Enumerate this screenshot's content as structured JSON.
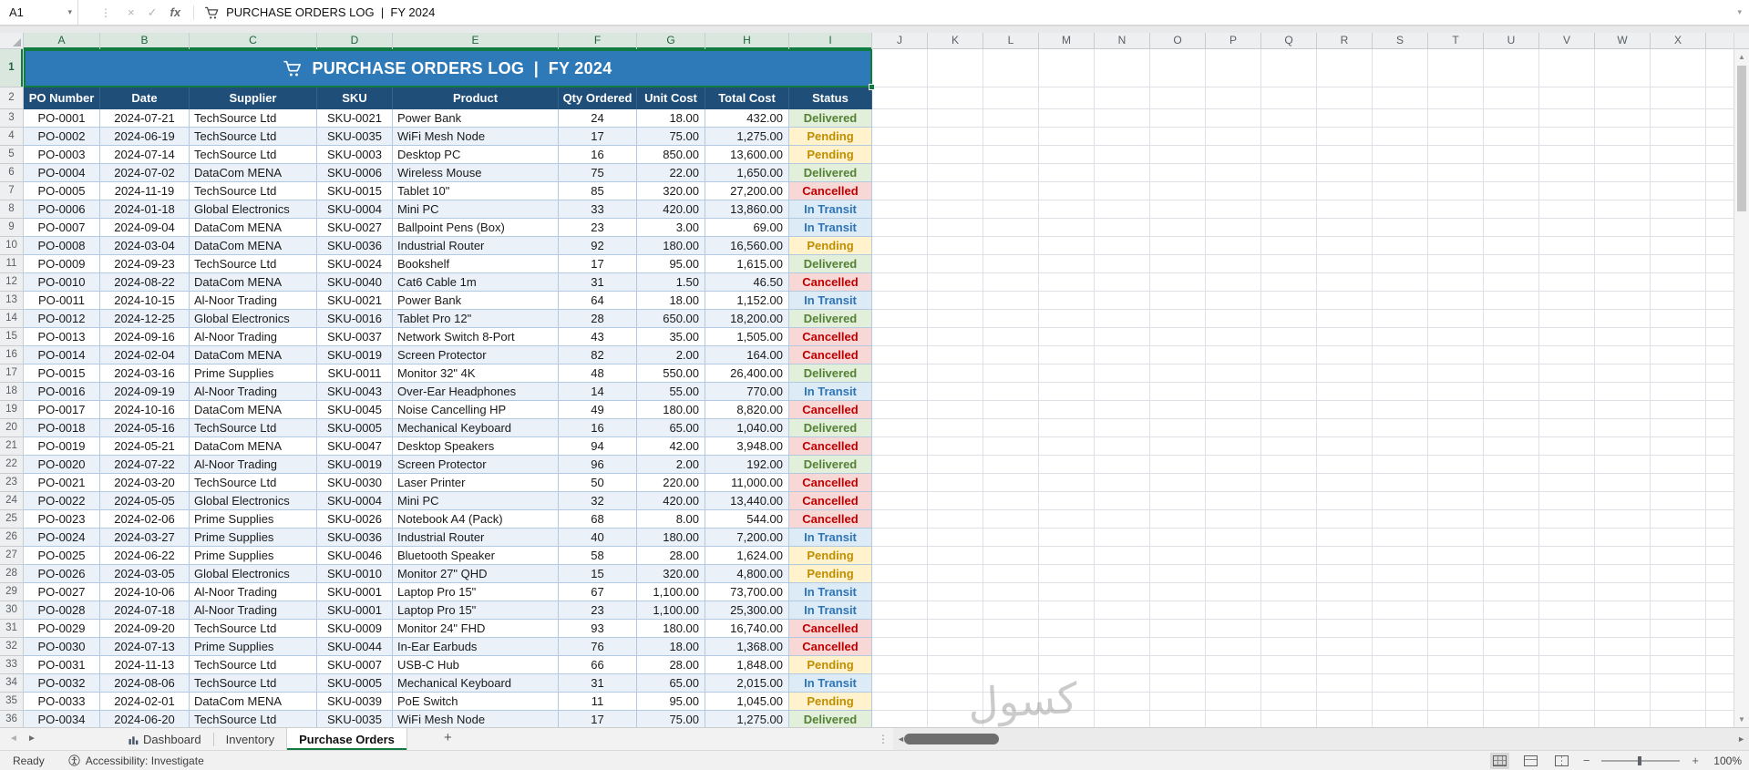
{
  "formula_bar": {
    "name_box": "A1",
    "fx_label": "fx",
    "formula_text": "PURCHASE ORDERS LOG  |  FY 2024"
  },
  "icons": {
    "dropdown": "▾",
    "cancel": "×",
    "confirm": "✓",
    "dots": "⋮",
    "tab_prev": "◄",
    "tab_next": "►",
    "scroll_left": "◄",
    "scroll_right": "►",
    "scroll_up": "▲",
    "scroll_down": "▼",
    "add_sheet": "+",
    "zoom_out": "−",
    "zoom_in": "+"
  },
  "grid": {
    "column_letters": [
      "A",
      "B",
      "C",
      "D",
      "E",
      "F",
      "G",
      "H",
      "I",
      "J",
      "K",
      "L",
      "M",
      "N",
      "O",
      "P",
      "Q",
      "R",
      "S",
      "T",
      "U",
      "V",
      "W",
      "X"
    ],
    "row_count": 36,
    "title": "PURCHASE ORDERS LOG  |  FY 2024",
    "columns": [
      "PO Number",
      "Date",
      "Supplier",
      "SKU",
      "Product",
      "Qty Ordered",
      "Unit Cost",
      "Total Cost",
      "Status"
    ],
    "rows": [
      [
        "PO-0001",
        "2024-07-21",
        "TechSource Ltd",
        "SKU-0021",
        "Power Bank",
        "24",
        "18.00",
        "432.00",
        "Delivered"
      ],
      [
        "PO-0002",
        "2024-06-19",
        "TechSource Ltd",
        "SKU-0035",
        "WiFi Mesh Node",
        "17",
        "75.00",
        "1,275.00",
        "Pending"
      ],
      [
        "PO-0003",
        "2024-07-14",
        "TechSource Ltd",
        "SKU-0003",
        "Desktop PC",
        "16",
        "850.00",
        "13,600.00",
        "Pending"
      ],
      [
        "PO-0004",
        "2024-07-02",
        "DataCom MENA",
        "SKU-0006",
        "Wireless Mouse",
        "75",
        "22.00",
        "1,650.00",
        "Delivered"
      ],
      [
        "PO-0005",
        "2024-11-19",
        "TechSource Ltd",
        "SKU-0015",
        "Tablet 10\"",
        "85",
        "320.00",
        "27,200.00",
        "Cancelled"
      ],
      [
        "PO-0006",
        "2024-01-18",
        "Global Electronics",
        "SKU-0004",
        "Mini PC",
        "33",
        "420.00",
        "13,860.00",
        "In Transit"
      ],
      [
        "PO-0007",
        "2024-09-04",
        "DataCom MENA",
        "SKU-0027",
        "Ballpoint Pens (Box)",
        "23",
        "3.00",
        "69.00",
        "In Transit"
      ],
      [
        "PO-0008",
        "2024-03-04",
        "DataCom MENA",
        "SKU-0036",
        "Industrial Router",
        "92",
        "180.00",
        "16,560.00",
        "Pending"
      ],
      [
        "PO-0009",
        "2024-09-23",
        "TechSource Ltd",
        "SKU-0024",
        "Bookshelf",
        "17",
        "95.00",
        "1,615.00",
        "Delivered"
      ],
      [
        "PO-0010",
        "2024-08-22",
        "DataCom MENA",
        "SKU-0040",
        "Cat6 Cable 1m",
        "31",
        "1.50",
        "46.50",
        "Cancelled"
      ],
      [
        "PO-0011",
        "2024-10-15",
        "Al-Noor Trading",
        "SKU-0021",
        "Power Bank",
        "64",
        "18.00",
        "1,152.00",
        "In Transit"
      ],
      [
        "PO-0012",
        "2024-12-25",
        "Global Electronics",
        "SKU-0016",
        "Tablet Pro 12\"",
        "28",
        "650.00",
        "18,200.00",
        "Delivered"
      ],
      [
        "PO-0013",
        "2024-09-16",
        "Al-Noor Trading",
        "SKU-0037",
        "Network Switch 8-Port",
        "43",
        "35.00",
        "1,505.00",
        "Cancelled"
      ],
      [
        "PO-0014",
        "2024-02-04",
        "DataCom MENA",
        "SKU-0019",
        "Screen Protector",
        "82",
        "2.00",
        "164.00",
        "Cancelled"
      ],
      [
        "PO-0015",
        "2024-03-16",
        "Prime Supplies",
        "SKU-0011",
        "Monitor 32\" 4K",
        "48",
        "550.00",
        "26,400.00",
        "Delivered"
      ],
      [
        "PO-0016",
        "2024-09-19",
        "Al-Noor Trading",
        "SKU-0043",
        "Over-Ear Headphones",
        "14",
        "55.00",
        "770.00",
        "In Transit"
      ],
      [
        "PO-0017",
        "2024-10-16",
        "DataCom MENA",
        "SKU-0045",
        "Noise Cancelling HP",
        "49",
        "180.00",
        "8,820.00",
        "Cancelled"
      ],
      [
        "PO-0018",
        "2024-05-16",
        "TechSource Ltd",
        "SKU-0005",
        "Mechanical Keyboard",
        "16",
        "65.00",
        "1,040.00",
        "Delivered"
      ],
      [
        "PO-0019",
        "2024-05-21",
        "DataCom MENA",
        "SKU-0047",
        "Desktop Speakers",
        "94",
        "42.00",
        "3,948.00",
        "Cancelled"
      ],
      [
        "PO-0020",
        "2024-07-22",
        "Al-Noor Trading",
        "SKU-0019",
        "Screen Protector",
        "96",
        "2.00",
        "192.00",
        "Delivered"
      ],
      [
        "PO-0021",
        "2024-03-20",
        "TechSource Ltd",
        "SKU-0030",
        "Laser Printer",
        "50",
        "220.00",
        "11,000.00",
        "Cancelled"
      ],
      [
        "PO-0022",
        "2024-05-05",
        "Global Electronics",
        "SKU-0004",
        "Mini PC",
        "32",
        "420.00",
        "13,440.00",
        "Cancelled"
      ],
      [
        "PO-0023",
        "2024-02-06",
        "Prime Supplies",
        "SKU-0026",
        "Notebook A4 (Pack)",
        "68",
        "8.00",
        "544.00",
        "Cancelled"
      ],
      [
        "PO-0024",
        "2024-03-27",
        "Prime Supplies",
        "SKU-0036",
        "Industrial Router",
        "40",
        "180.00",
        "7,200.00",
        "In Transit"
      ],
      [
        "PO-0025",
        "2024-06-22",
        "Prime Supplies",
        "SKU-0046",
        "Bluetooth Speaker",
        "58",
        "28.00",
        "1,624.00",
        "Pending"
      ],
      [
        "PO-0026",
        "2024-03-05",
        "Global Electronics",
        "SKU-0010",
        "Monitor 27\" QHD",
        "15",
        "320.00",
        "4,800.00",
        "Pending"
      ],
      [
        "PO-0027",
        "2024-10-06",
        "Al-Noor Trading",
        "SKU-0001",
        "Laptop Pro 15\"",
        "67",
        "1,100.00",
        "73,700.00",
        "In Transit"
      ],
      [
        "PO-0028",
        "2024-07-18",
        "Al-Noor Trading",
        "SKU-0001",
        "Laptop Pro 15\"",
        "23",
        "1,100.00",
        "25,300.00",
        "In Transit"
      ],
      [
        "PO-0029",
        "2024-09-20",
        "TechSource Ltd",
        "SKU-0009",
        "Monitor 24\" FHD",
        "93",
        "180.00",
        "16,740.00",
        "Cancelled"
      ],
      [
        "PO-0030",
        "2024-07-13",
        "Prime Supplies",
        "SKU-0044",
        "In-Ear Earbuds",
        "76",
        "18.00",
        "1,368.00",
        "Cancelled"
      ],
      [
        "PO-0031",
        "2024-11-13",
        "TechSource Ltd",
        "SKU-0007",
        "USB-C Hub",
        "66",
        "28.00",
        "1,848.00",
        "Pending"
      ],
      [
        "PO-0032",
        "2024-08-06",
        "TechSource Ltd",
        "SKU-0005",
        "Mechanical Keyboard",
        "31",
        "65.00",
        "2,015.00",
        "In Transit"
      ],
      [
        "PO-0033",
        "2024-02-01",
        "DataCom MENA",
        "SKU-0039",
        "PoE Switch",
        "11",
        "95.00",
        "1,045.00",
        "Pending"
      ],
      [
        "PO-0034",
        "2024-06-20",
        "TechSource Ltd",
        "SKU-0035",
        "WiFi Mesh Node",
        "17",
        "75.00",
        "1,275.00",
        "Delivered"
      ]
    ]
  },
  "status_styles": {
    "Delivered": {
      "bg": "#E2EFDA",
      "fg": "#548235"
    },
    "Pending": {
      "bg": "#FFF2CC",
      "fg": "#BF8F00"
    },
    "Cancelled": {
      "bg": "#F8D7D7",
      "fg": "#C00000"
    },
    "In Transit": {
      "bg": "#DDEBF7",
      "fg": "#2E75B6"
    }
  },
  "theme": {
    "title_bg": "#2E79B8",
    "header_bg": "#1F4E79",
    "band": "#EAF1F9",
    "selection_green": "#107C41",
    "grid_line": "#DDE1E5",
    "table_line": "#B3C9E0",
    "chrome_bg": "#EDEFF1",
    "chrome_border": "#C9CDD1"
  },
  "sheet_tabs": {
    "tabs": [
      {
        "label": "Dashboard",
        "active": false
      },
      {
        "label": "Inventory",
        "active": false
      },
      {
        "label": "Purchase Orders",
        "active": true
      }
    ]
  },
  "status_bar": {
    "ready": "Ready",
    "accessibility": "Accessibility: Investigate",
    "zoom": "100%"
  },
  "watermark": "كسول"
}
